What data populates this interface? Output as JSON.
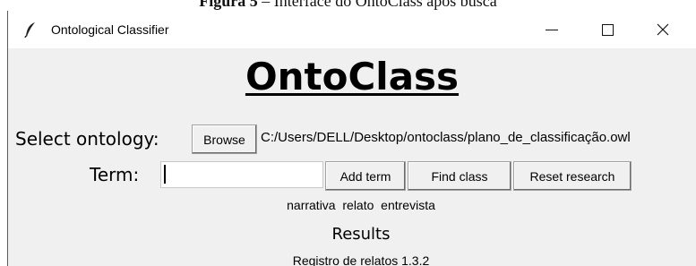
{
  "caption": {
    "label": "Figura 5",
    "text": " – Interface do OntoClass após busca"
  },
  "window": {
    "title": "Ontological Classifier",
    "icon": "feather-icon"
  },
  "app": {
    "heading": "OntoClass"
  },
  "ontology": {
    "label": "Select ontology:",
    "browse_label": "Browse",
    "path": "C:/Users/DELL/Desktop/ontoclass/plano_de_classificação.owl"
  },
  "term": {
    "label": "Term:",
    "value": "",
    "add_label": "Add term",
    "find_label": "Find class",
    "reset_label": "Reset research"
  },
  "keywords": "narrativa  relato  entrevista",
  "results": {
    "label": "Results",
    "items": [
      "Registro de relatos 1.3.2"
    ]
  }
}
